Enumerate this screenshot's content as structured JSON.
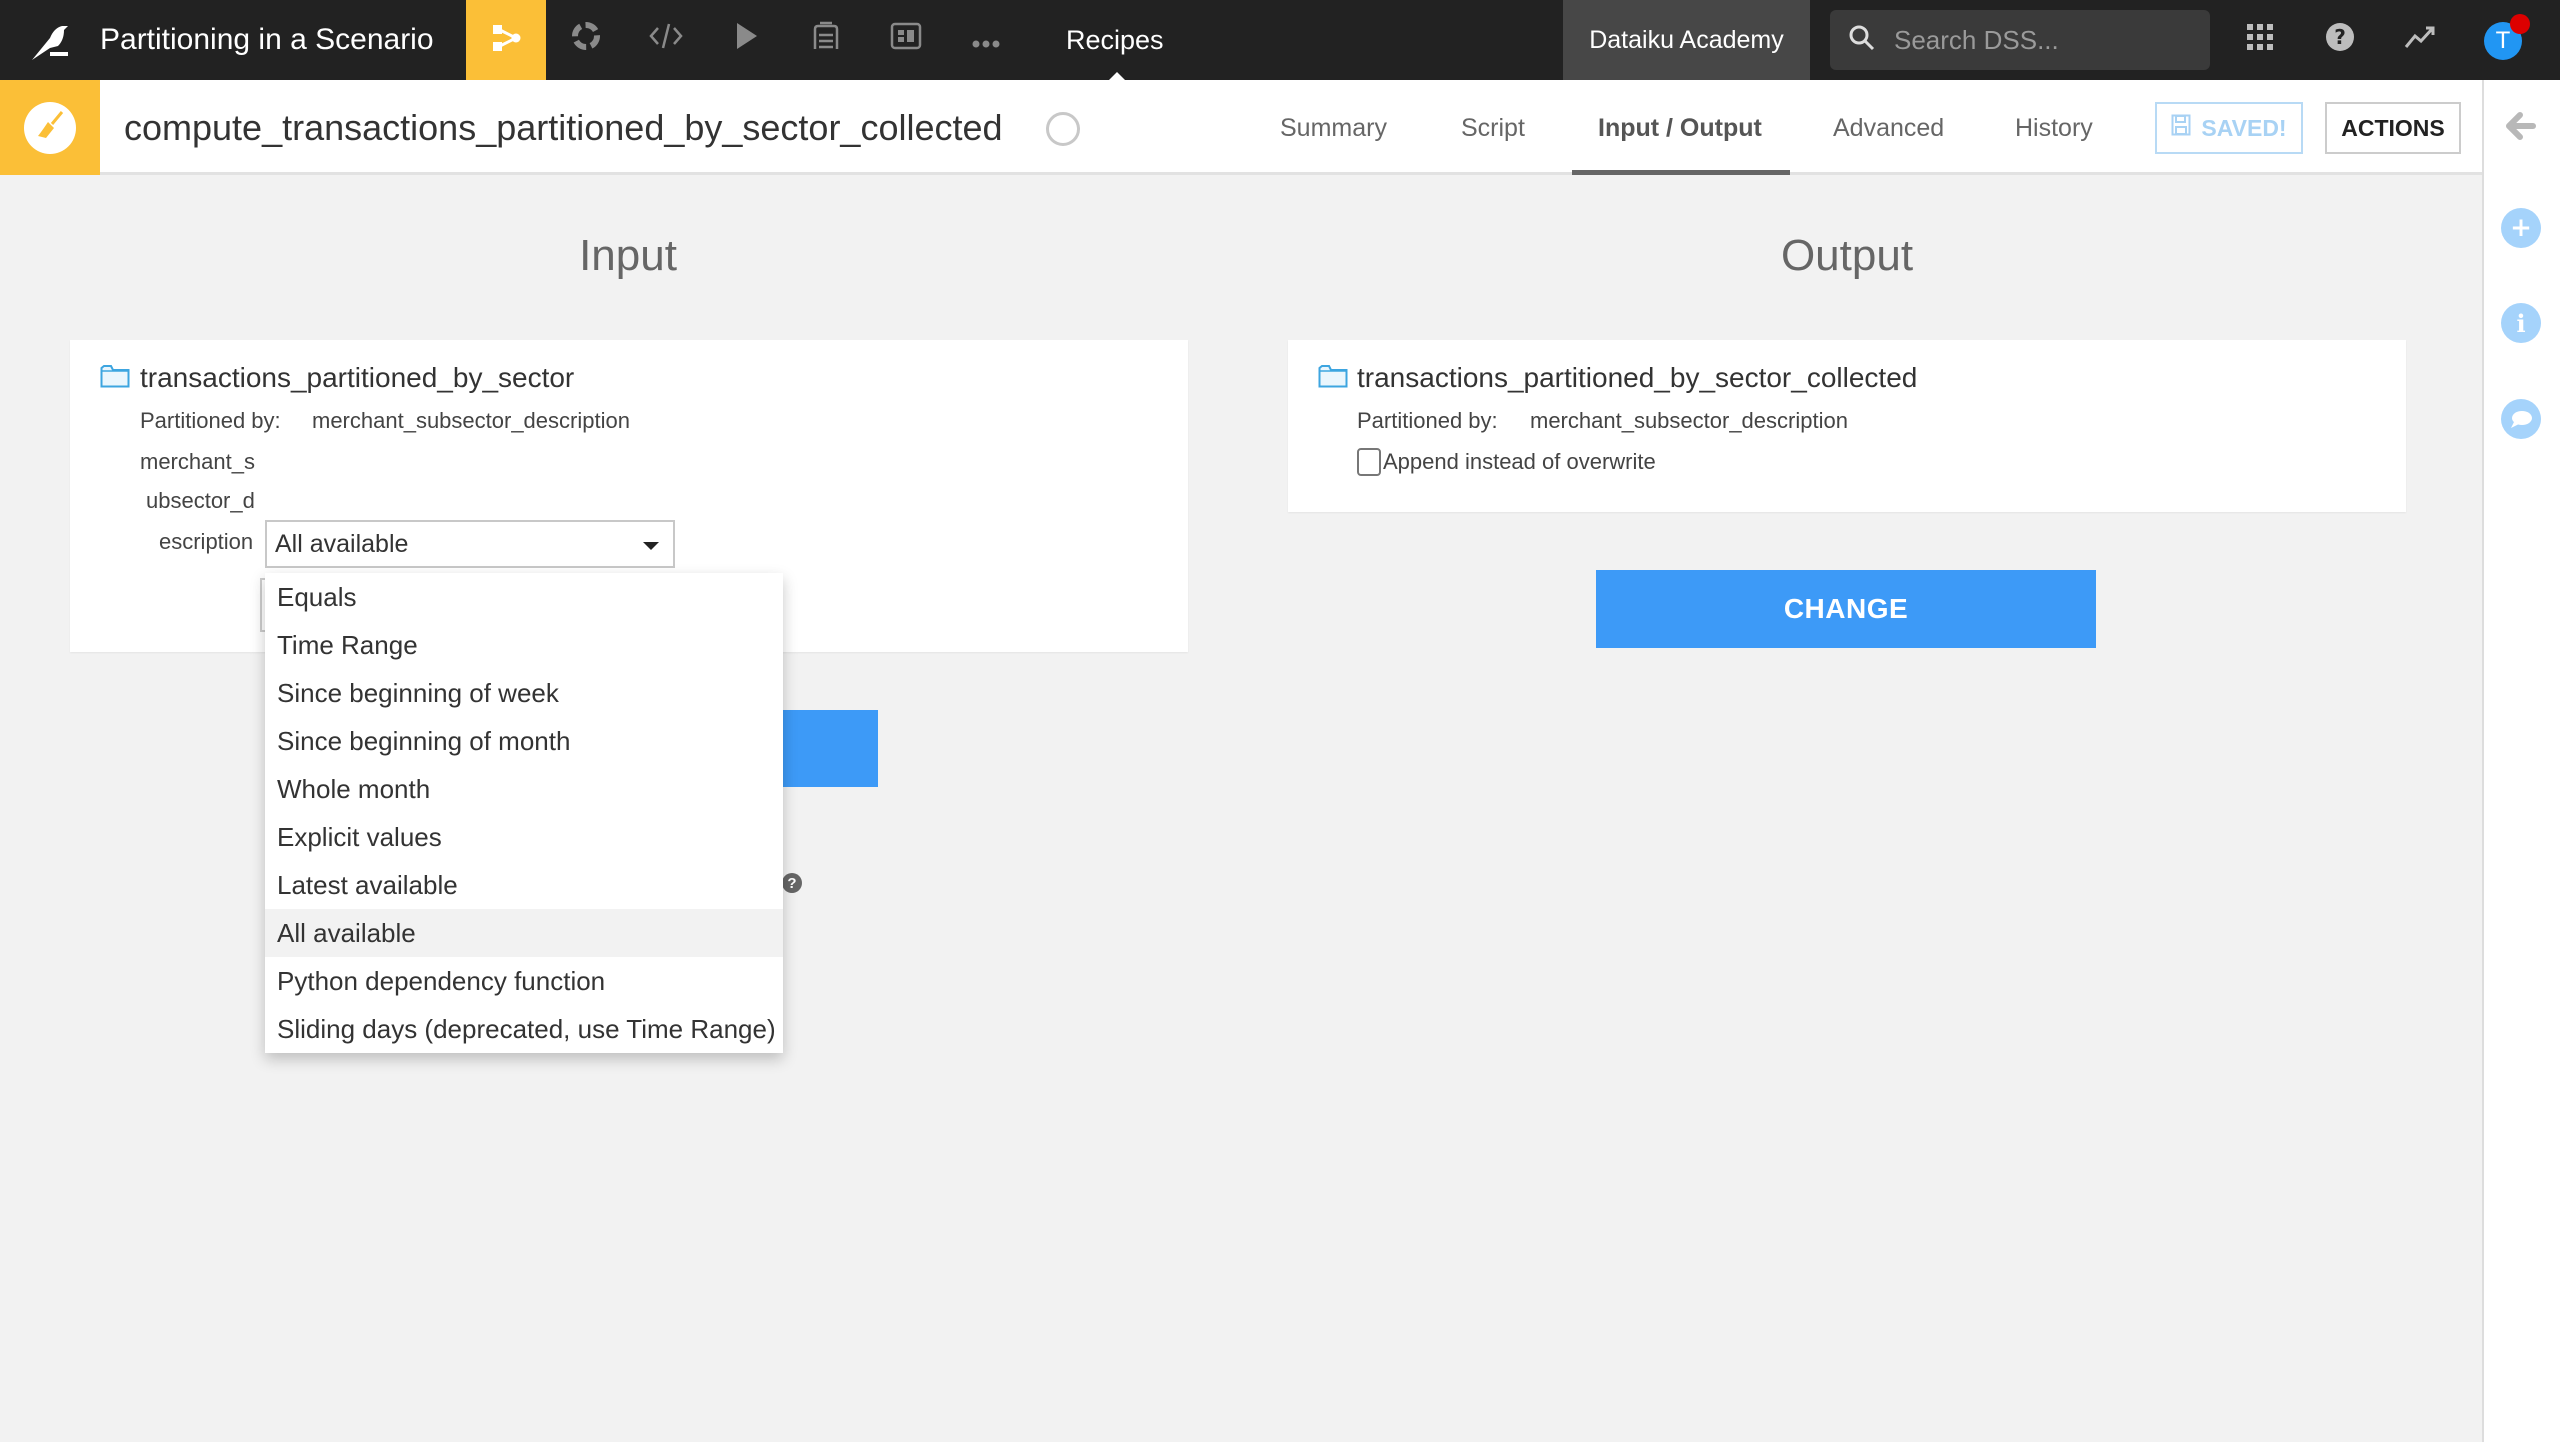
{
  "topbar": {
    "project_title": "Partitioning in a Scenario",
    "nav_icons": [
      "flow-icon",
      "refresh-cycle-icon",
      "code-icon",
      "run-icon",
      "library-icon",
      "dashboard-icon",
      "more-icon"
    ],
    "current_section": "Recipes",
    "instance_name": "Dataiku Academy",
    "search": {
      "placeholder": "Search DSS..."
    },
    "right_icons": [
      "apps-grid-icon",
      "help-icon",
      "activity-icon"
    ],
    "avatar_initial": "T",
    "accent_color": "#fbbf37"
  },
  "recipe": {
    "name": "compute_transactions_partitioned_by_sector_collected",
    "tabs": [
      {
        "label": "Summary",
        "active": false
      },
      {
        "label": "Script",
        "active": false
      },
      {
        "label": "Input / Output",
        "active": true
      },
      {
        "label": "Advanced",
        "active": false
      },
      {
        "label": "History",
        "active": false
      }
    ],
    "saved_label": "SAVED!",
    "actions_label": "ACTIONS"
  },
  "input": {
    "title": "Input",
    "dataset_name": "transactions_partitioned_by_sector",
    "partitioned_by_label": "Partitioned by:",
    "partitioned_by_value": "merchant_subsector_description",
    "dimension_label_lines": [
      "merchant_s",
      "ubsector_d",
      "escription"
    ],
    "dependency_select": {
      "selected": "All available",
      "options": [
        "Equals",
        "Time Range",
        "Since beginning of week",
        "Since beginning of month",
        "Whole month",
        "Explicit values",
        "Latest available",
        "All available",
        "Python dependency function",
        "Sliding days (deprecated, use Time Range)"
      ]
    }
  },
  "output": {
    "title": "Output",
    "dataset_name": "transactions_partitioned_by_sector_collected",
    "partitioned_by_label": "Partitioned by:",
    "partitioned_by_value": "merchant_subsector_description",
    "append_label": "Append instead of overwrite",
    "append_checked": false,
    "change_label": "CHANGE"
  },
  "right_sidebar": [
    "back-arrow-icon",
    "add-icon",
    "info-icon",
    "discussion-icon"
  ],
  "colors": {
    "primary_button": "#3d9af7",
    "topbar_bg": "#222222",
    "sidebar_icon": "#a5d3fb"
  }
}
